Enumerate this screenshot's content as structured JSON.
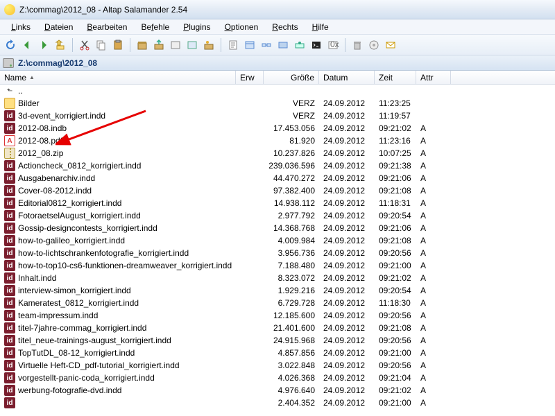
{
  "window": {
    "title": "Z:\\commag\\2012_08 - Altap Salamander 2.54"
  },
  "menu": [
    "Links",
    "Dateien",
    "Bearbeiten",
    "Befehle",
    "Plugins",
    "Optionen",
    "Rechts",
    "Hilfe"
  ],
  "path": "Z:\\commag\\2012_08",
  "columns": {
    "name": "Name",
    "ext": "Erw",
    "size": "Größe",
    "date": "Datum",
    "time": "Zeit",
    "attr": "Attr"
  },
  "rows": [
    {
      "icon": "up",
      "name": "..",
      "size": "",
      "date": "",
      "time": "",
      "attr": ""
    },
    {
      "icon": "folder",
      "name": "Bilder",
      "size": "VERZ",
      "date": "24.09.2012",
      "time": "11:23:25",
      "attr": ""
    },
    {
      "icon": "indd",
      "name": "3d-event_korrigiert.indd",
      "size": "VERZ",
      "date": "24.09.2012",
      "time": "11:19:57",
      "attr": ""
    },
    {
      "icon": "indd",
      "name": "2012-08.indb",
      "size": "17.453.056",
      "date": "24.09.2012",
      "time": "09:21:02",
      "attr": "A"
    },
    {
      "icon": "pdf",
      "name": "2012-08.pdf",
      "size": "81.920",
      "date": "24.09.2012",
      "time": "11:23:16",
      "attr": "A"
    },
    {
      "icon": "zip",
      "name": "2012_08.zip",
      "size": "10.237.826",
      "date": "24.09.2012",
      "time": "10:07:25",
      "attr": "A"
    },
    {
      "icon": "indd",
      "name": "Actioncheck_0812_korrigiert.indd",
      "size": "239.036.596",
      "date": "24.09.2012",
      "time": "09:21:38",
      "attr": "A"
    },
    {
      "icon": "indd",
      "name": "Ausgabenarchiv.indd",
      "size": "44.470.272",
      "date": "24.09.2012",
      "time": "09:21:06",
      "attr": "A"
    },
    {
      "icon": "indd",
      "name": "Cover-08-2012.indd",
      "size": "97.382.400",
      "date": "24.09.2012",
      "time": "09:21:08",
      "attr": "A"
    },
    {
      "icon": "indd",
      "name": "Editorial0812_korrigiert.indd",
      "size": "14.938.112",
      "date": "24.09.2012",
      "time": "11:18:31",
      "attr": "A"
    },
    {
      "icon": "indd",
      "name": "FotoraetselAugust_korrigiert.indd",
      "size": "2.977.792",
      "date": "24.09.2012",
      "time": "09:20:54",
      "attr": "A"
    },
    {
      "icon": "indd",
      "name": "Gossip-designcontests_korrigiert.indd",
      "size": "14.368.768",
      "date": "24.09.2012",
      "time": "09:21:06",
      "attr": "A"
    },
    {
      "icon": "indd",
      "name": "how-to-galileo_korrigiert.indd",
      "size": "4.009.984",
      "date": "24.09.2012",
      "time": "09:21:08",
      "attr": "A"
    },
    {
      "icon": "indd",
      "name": "how-to-lichtschrankenfotografie_korrigiert.indd",
      "size": "3.956.736",
      "date": "24.09.2012",
      "time": "09:20:56",
      "attr": "A"
    },
    {
      "icon": "indd",
      "name": "how-to-top10-cs6-funktionen-dreamweaver_korrigiert.indd",
      "size": "7.188.480",
      "date": "24.09.2012",
      "time": "09:21:00",
      "attr": "A"
    },
    {
      "icon": "indd",
      "name": "Inhalt.indd",
      "size": "8.323.072",
      "date": "24.09.2012",
      "time": "09:21:02",
      "attr": "A"
    },
    {
      "icon": "indd",
      "name": "interview-simon_korrigiert.indd",
      "size": "1.929.216",
      "date": "24.09.2012",
      "time": "09:20:54",
      "attr": "A"
    },
    {
      "icon": "indd",
      "name": "Kameratest_0812_korrigiert.indd",
      "size": "6.729.728",
      "date": "24.09.2012",
      "time": "11:18:30",
      "attr": "A"
    },
    {
      "icon": "indd",
      "name": "team-impressum.indd",
      "size": "12.185.600",
      "date": "24.09.2012",
      "time": "09:20:56",
      "attr": "A"
    },
    {
      "icon": "indd",
      "name": "titel-7jahre-commag_korrigiert.indd",
      "size": "21.401.600",
      "date": "24.09.2012",
      "time": "09:21:08",
      "attr": "A"
    },
    {
      "icon": "indd",
      "name": "titel_neue-trainings-august_korrigiert.indd",
      "size": "24.915.968",
      "date": "24.09.2012",
      "time": "09:20:56",
      "attr": "A"
    },
    {
      "icon": "indd",
      "name": "TopTutDL_08-12_korrigiert.indd",
      "size": "4.857.856",
      "date": "24.09.2012",
      "time": "09:21:00",
      "attr": "A"
    },
    {
      "icon": "indd",
      "name": "Virtuelle Heft-CD_pdf-tutorial_korrigiert.indd",
      "size": "3.022.848",
      "date": "24.09.2012",
      "time": "09:20:56",
      "attr": "A"
    },
    {
      "icon": "indd",
      "name": "vorgestellt-panic-coda_korrigiert.indd",
      "size": "4.026.368",
      "date": "24.09.2012",
      "time": "09:21:04",
      "attr": "A"
    },
    {
      "icon": "indd",
      "name": "werbung-fotografie-dvd.indd",
      "size": "4.976.640",
      "date": "24.09.2012",
      "time": "09:21:02",
      "attr": "A"
    },
    {
      "icon": "indd",
      "name": "",
      "size": "2.404.352",
      "date": "24.09.2012",
      "time": "09:21:00",
      "attr": "A"
    }
  ]
}
